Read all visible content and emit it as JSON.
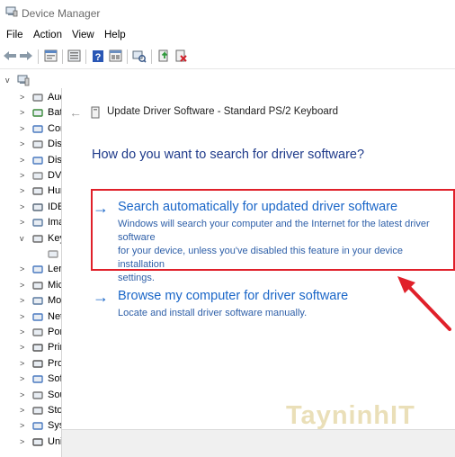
{
  "window": {
    "title": "Device Manager"
  },
  "menu": [
    "File",
    "Action",
    "View",
    "Help"
  ],
  "toolbar": {
    "icons": [
      "back-icon",
      "forward-icon",
      "properties-icon",
      "show-hide-icon",
      "help-icon",
      "view-icon",
      "scan-hardware-icon",
      "update-driver-icon",
      "uninstall-icon"
    ]
  },
  "tree": {
    "root_expander": "v",
    "items": [
      {
        "label": "Aud",
        "expander": ">"
      },
      {
        "label": "Bat",
        "expander": ">"
      },
      {
        "label": "Cor",
        "expander": ">"
      },
      {
        "label": "Disl",
        "expander": ">"
      },
      {
        "label": "Disp",
        "expander": ">"
      },
      {
        "label": "DVD",
        "expander": ">"
      },
      {
        "label": "Hur",
        "expander": ">"
      },
      {
        "label": "IDE",
        "expander": ">"
      },
      {
        "label": "Ima",
        "expander": ">"
      },
      {
        "label": "Key",
        "expander": "v"
      },
      {
        "label": "",
        "expander": ""
      },
      {
        "label": "Len",
        "expander": ">"
      },
      {
        "label": "Mic",
        "expander": ">"
      },
      {
        "label": "Mo",
        "expander": ">"
      },
      {
        "label": "Net",
        "expander": ">"
      },
      {
        "label": "Por",
        "expander": ">"
      },
      {
        "label": "Prir",
        "expander": ">"
      },
      {
        "label": "Pro",
        "expander": ">"
      },
      {
        "label": "Sof",
        "expander": ">"
      },
      {
        "label": "Sou",
        "expander": ">"
      },
      {
        "label": "Sto",
        "expander": ">"
      },
      {
        "label": "Sys",
        "expander": ">"
      },
      {
        "label": "Uni",
        "expander": ">"
      }
    ]
  },
  "dialog": {
    "back": "←",
    "title": "Update Driver Software - Standard PS/2 Keyboard",
    "question": "How do you want to search for driver software?",
    "options": [
      {
        "arrow": "→",
        "title": "Search automatically for updated driver software",
        "desc_lines": [
          "Windows will search your computer and the Internet for the latest driver software",
          "for your device, unless you've disabled this feature in your device installation",
          "settings."
        ]
      },
      {
        "arrow": "→",
        "title": "Browse my computer for driver software",
        "desc_lines": [
          "Locate and install driver software manually."
        ]
      }
    ]
  },
  "watermark": "TayninhIT",
  "colors": {
    "link": "#1a66c8",
    "heading": "#1e3a8a",
    "highlight": "#e0202a",
    "annotation_arrow": "#e0202a"
  }
}
